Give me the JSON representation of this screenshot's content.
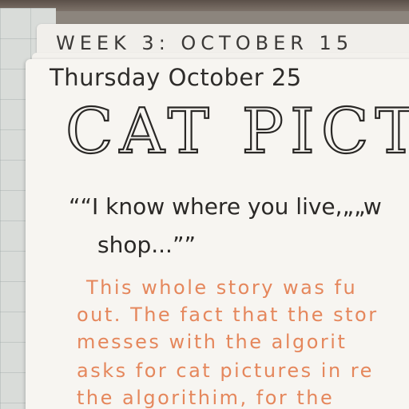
{
  "notebook": {
    "week_header": "WEEK 3: OCTOBER 15",
    "date_line": "Thursday October 25",
    "title": "CAT PICTURES",
    "quote_lines": [
      "““I know where you live,„„w",
      "shop...””"
    ],
    "note_lines": [
      "This whole story was fu",
      "out. The fact that the stor",
      "messes with the algorit",
      "asks for cat pictures in re",
      "the algorithim, for the"
    ]
  },
  "colors": {
    "ink": "#2a2826",
    "orange_ink": "#e5875c",
    "paper": "#f7f5f1"
  }
}
